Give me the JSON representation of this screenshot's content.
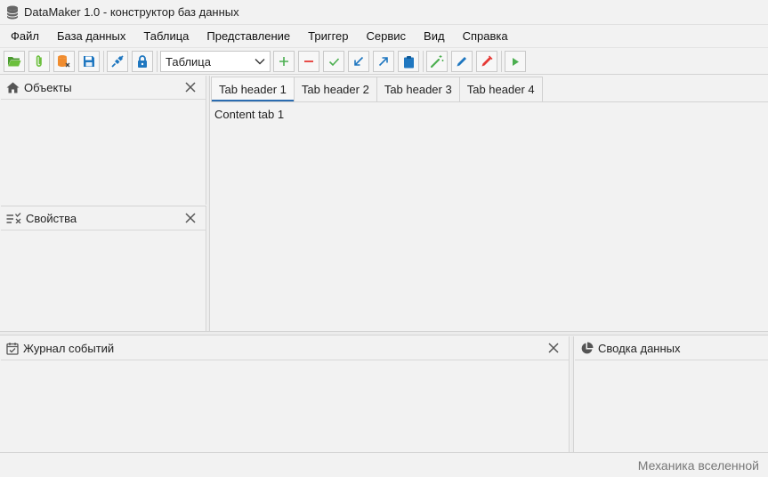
{
  "window": {
    "title": "DataMaker 1.0 - конструктор баз данных"
  },
  "menu": [
    "Файл",
    "База данных",
    "Таблица",
    "Представление",
    "Триггер",
    "Сервис",
    "Вид",
    "Справка"
  ],
  "toolbar": {
    "combo_value": "Таблица"
  },
  "panels": {
    "objects": {
      "title": "Объекты"
    },
    "properties": {
      "title": "Свойства"
    },
    "events": {
      "title": "Журнал событий"
    },
    "summary": {
      "title": "Сводка данных"
    }
  },
  "tabs": [
    "Tab header 1",
    "Tab header 2",
    "Tab header 3",
    "Tab header 4"
  ],
  "content": {
    "active_tab_text": "Content tab 1"
  },
  "status": {
    "text": "Механика вселенной"
  },
  "colors": {
    "accent": "#2b6cb0",
    "green": "#4caf50",
    "red": "#e53935",
    "orange": "#f08c2e",
    "blue": "#1f77c0"
  }
}
